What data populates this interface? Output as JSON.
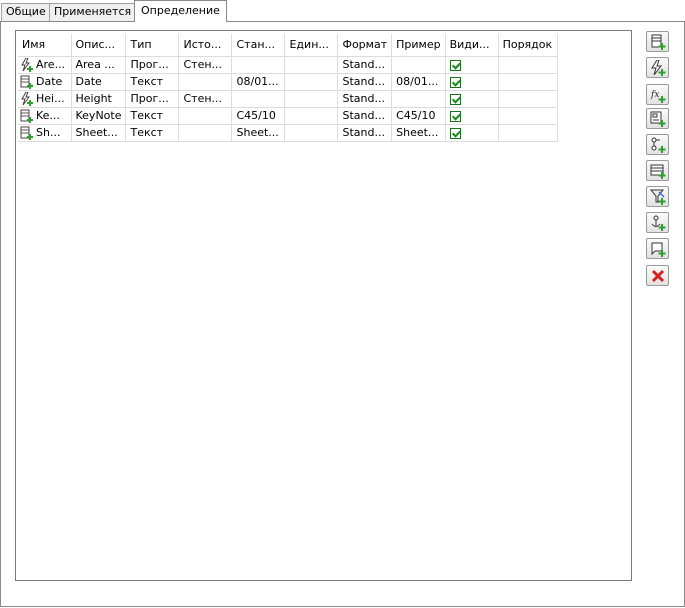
{
  "tabs": [
    {
      "label": "Общие"
    },
    {
      "label": "Применяется к"
    },
    {
      "label": "Определение"
    }
  ],
  "columns": [
    "Имя",
    "Опис...",
    "Тип",
    "Исто...",
    "Стан...",
    "Един...",
    "Формат",
    "Пример",
    "Види...",
    "Порядок"
  ],
  "rows": [
    {
      "icon": "lightning-add-icon",
      "name": "Are...",
      "desc": "Area ...",
      "type": "Прог...",
      "source": "Стен...",
      "standard": "",
      "unit": "",
      "format": "Stand...",
      "example": "",
      "visible": true,
      "order": ""
    },
    {
      "icon": "property-add-icon",
      "name": "Date",
      "desc": "Date",
      "type": "Текст",
      "source": "",
      "standard": "08/01...",
      "unit": "",
      "format": "Stand...",
      "example": "08/01...",
      "visible": true,
      "order": ""
    },
    {
      "icon": "lightning-add-icon",
      "name": "Hei...",
      "desc": "Height",
      "type": "Прог...",
      "source": "Стен...",
      "standard": "",
      "unit": "",
      "format": "Stand...",
      "example": "",
      "visible": true,
      "order": ""
    },
    {
      "icon": "property-add-icon",
      "name": "Ke...",
      "desc": "KeyNote",
      "type": "Текст",
      "source": "",
      "standard": "C45/10",
      "unit": "",
      "format": "Stand...",
      "example": "C45/10",
      "visible": true,
      "order": ""
    },
    {
      "icon": "property-add-icon",
      "name": "Sh...",
      "desc": "Sheet...",
      "type": "Текст",
      "source": "",
      "standard": "Sheet...",
      "unit": "",
      "format": "Stand...",
      "example": "Sheet...",
      "visible": true,
      "order": ""
    }
  ],
  "side_buttons": [
    {
      "icon": "add-property-icon"
    },
    {
      "icon": "add-automatic-property-icon"
    },
    {
      "icon": "add-formula-icon"
    },
    {
      "icon": "add-block-property-icon"
    },
    {
      "icon": "add-graph-property-icon"
    },
    {
      "icon": "add-table-property-icon"
    },
    {
      "icon": "add-filter-property-icon"
    },
    {
      "icon": "add-anchor-property-icon"
    },
    {
      "icon": "add-shape-property-icon"
    },
    {
      "icon": "delete-icon"
    }
  ],
  "colors": {
    "add_green": "#2e9e2e",
    "delete_red": "#d42020",
    "check_green": "#1a8a1a"
  }
}
